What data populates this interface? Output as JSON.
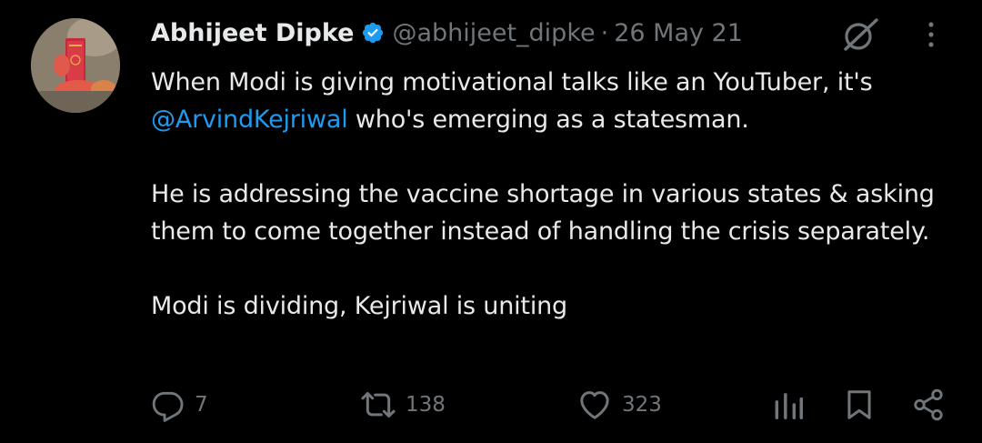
{
  "tweet": {
    "author": {
      "display_name": "Abhijeet Dipke",
      "handle": "@abhijeet_dipke",
      "verified": true,
      "avatar": "avatar-photo-person-holding-red-book"
    },
    "separator": "·",
    "date": "26 May 21",
    "body": {
      "line1_text": "When Modi is giving motivational talks like an YouTuber, it's",
      "mention": "@ArvindKejriwal",
      "line2_rest": " who's emerging as a statesman.",
      "paragraph2": "He is addressing the vaccine shortage in various states & asking them to come together instead of handling the crisis separately.",
      "paragraph3": "Modi is dividing, Kejriwal is uniting"
    },
    "stats": {
      "replies": "7",
      "reposts": "138",
      "likes": "323"
    }
  },
  "icons": {
    "verified": "verified-badge-icon",
    "grok": "grok-icon",
    "more": "more-vertical-icon",
    "reply": "reply-icon",
    "repost": "repost-icon",
    "like": "heart-icon",
    "views": "analytics-icon",
    "bookmark": "bookmark-icon",
    "share": "share-icon"
  },
  "colors": {
    "background": "#000000",
    "text": "#e7e9ea",
    "secondary": "#71767b",
    "link": "#1d9bf0",
    "verified": "#1d9bf0"
  }
}
